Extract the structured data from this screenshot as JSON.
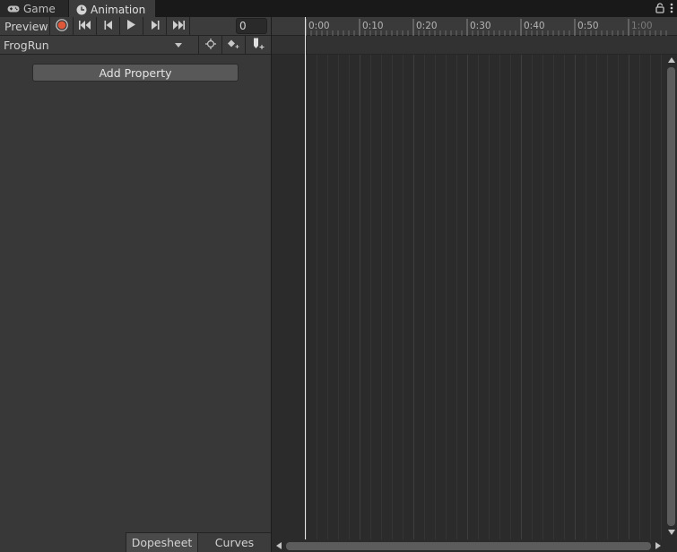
{
  "tabs": {
    "game_label": "Game",
    "animation_label": "Animation"
  },
  "toolbar": {
    "preview_label": "Preview",
    "frame_value": "0"
  },
  "clip": {
    "selected": "FrogRun"
  },
  "left_panel": {
    "add_property_label": "Add Property"
  },
  "bottom_tabs": {
    "dopesheet_label": "Dopesheet",
    "curves_label": "Curves"
  },
  "timeline": {
    "ticks": [
      "0:00",
      "0:10",
      "0:20",
      "0:30",
      "0:40",
      "0:50",
      "1:00"
    ]
  },
  "colors": {
    "record_button": "#e0583a",
    "playhead": "#e6e6e6"
  }
}
